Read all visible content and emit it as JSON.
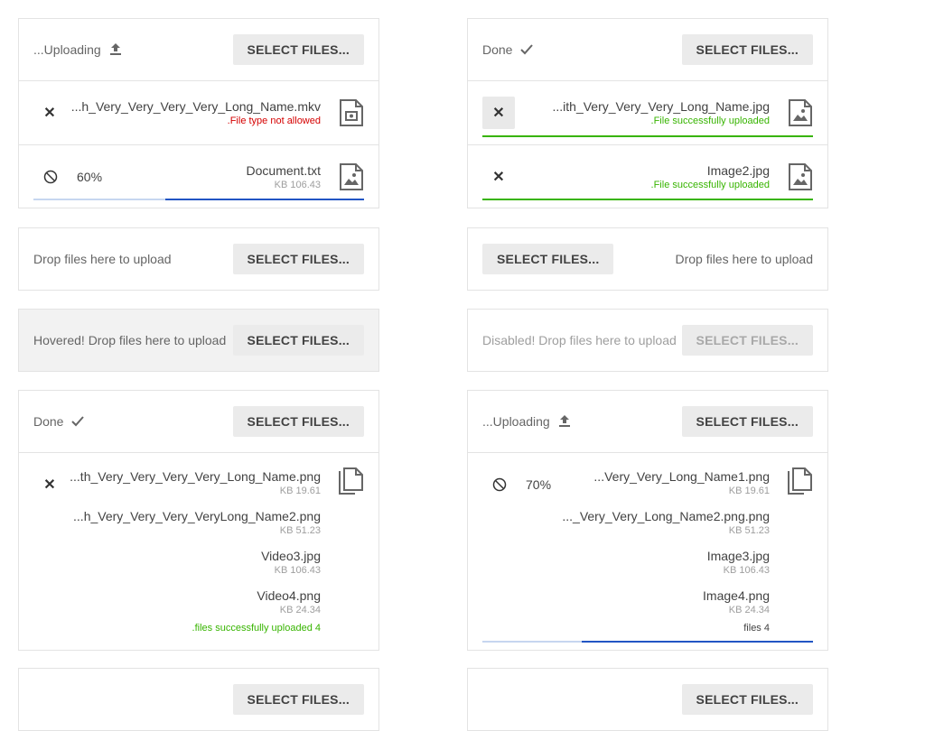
{
  "select_label": "SELECT FILES...",
  "uploads": {
    "a": {
      "status": "...Uploading",
      "files": [
        {
          "name": "...h_Very_Very_Very_Very_Long_Name.mkv",
          "meta": ".File type not allowed"
        },
        {
          "name": "Document.txt",
          "meta": "KB 106.43",
          "progress": "60%",
          "progress_value": 60
        }
      ]
    },
    "b": {
      "status": "Done",
      "files": [
        {
          "name": "...ith_Very_Very_Very_Long_Name.jpg",
          "meta": ".File successfully uploaded"
        },
        {
          "name": "Image2.jpg",
          "meta": ".File successfully uploaded"
        }
      ]
    },
    "c": {
      "hint": "Drop files here to upload"
    },
    "d": {
      "hint": "Drop files here to upload"
    },
    "e": {
      "hint": "Hovered! Drop files here to upload"
    },
    "f": {
      "hint": "Disabled! Drop files here to upload"
    },
    "g": {
      "status": "Done",
      "files": [
        {
          "name": "...th_Very_Very_Very_Very_Long_Name.png",
          "size": "KB 19.61"
        },
        {
          "name": "...h_Very_Very_Very_VeryLong_Name2.png",
          "size": "KB 51.23"
        },
        {
          "name": "Video3.jpg",
          "size": "KB 106.43"
        },
        {
          "name": "Video4.png",
          "size": "KB 24.34"
        }
      ],
      "summary": ".files successfully uploaded 4"
    },
    "h": {
      "status": "...Uploading",
      "progress": "70%",
      "progress_value": 70,
      "files": [
        {
          "name": "...Very_Very_Long_Name1.png",
          "size": "KB 19.61"
        },
        {
          "name": "..._Very_Very_Long_Name2.png.png",
          "size": "KB 51.23"
        },
        {
          "name": "Image3.jpg",
          "size": "KB 106.43"
        },
        {
          "name": "Image4.png",
          "size": "KB 24.34"
        }
      ],
      "summary": "files 4"
    }
  },
  "colors": {
    "error": "#d50000",
    "success": "#37b400",
    "progress": "#2255c4"
  }
}
